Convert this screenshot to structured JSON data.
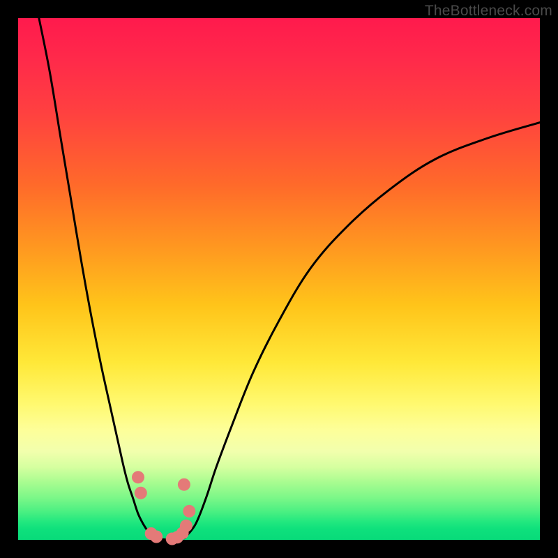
{
  "watermark": "TheBottleneck.com",
  "colors": {
    "frame": "#000000",
    "curve": "#000000",
    "marker": "#e47a78",
    "gradient_top": "#ff1a4d",
    "gradient_mid": "#ffe838",
    "gradient_bottom": "#08db7a"
  },
  "chart_data": {
    "type": "line",
    "title": "",
    "xlabel": "",
    "ylabel": "",
    "xlim": [
      0,
      100
    ],
    "ylim": [
      0,
      100
    ],
    "grid": false,
    "legend": false,
    "note": "Axes carry no visible tick labels; values below are pixel-read estimates on a 0–100 x-axis and 0–100 y-axis (0 = bottom/green, 100 = top/red).",
    "series": [
      {
        "name": "left-branch",
        "x": [
          4,
          6,
          8,
          10,
          12,
          14,
          16,
          18,
          20,
          21,
          22,
          23,
          24,
          25,
          26
        ],
        "y": [
          100,
          90,
          78,
          66,
          54,
          43,
          33,
          24,
          15,
          11,
          8,
          5,
          3,
          1.5,
          0.5
        ]
      },
      {
        "name": "right-branch",
        "x": [
          32,
          34,
          36,
          38,
          41,
          45,
          50,
          56,
          63,
          71,
          80,
          90,
          100
        ],
        "y": [
          0.5,
          3,
          8,
          14,
          22,
          32,
          42,
          52,
          60,
          67,
          73,
          77,
          80
        ]
      },
      {
        "name": "trough",
        "x": [
          26,
          27,
          28,
          29,
          30,
          31,
          32
        ],
        "y": [
          0.5,
          0.2,
          0.1,
          0.1,
          0.1,
          0.2,
          0.5
        ]
      }
    ],
    "markers": [
      {
        "x": 23.0,
        "y": 12.0
      },
      {
        "x": 23.5,
        "y": 9.0
      },
      {
        "x": 25.5,
        "y": 1.2
      },
      {
        "x": 26.5,
        "y": 0.6
      },
      {
        "x": 29.5,
        "y": 0.2
      },
      {
        "x": 30.5,
        "y": 0.5
      },
      {
        "x": 31.5,
        "y": 1.3
      },
      {
        "x": 32.2,
        "y": 2.7
      },
      {
        "x": 32.8,
        "y": 5.5
      },
      {
        "x": 31.8,
        "y": 10.6
      }
    ],
    "marker_radius_pct": 1.2
  }
}
